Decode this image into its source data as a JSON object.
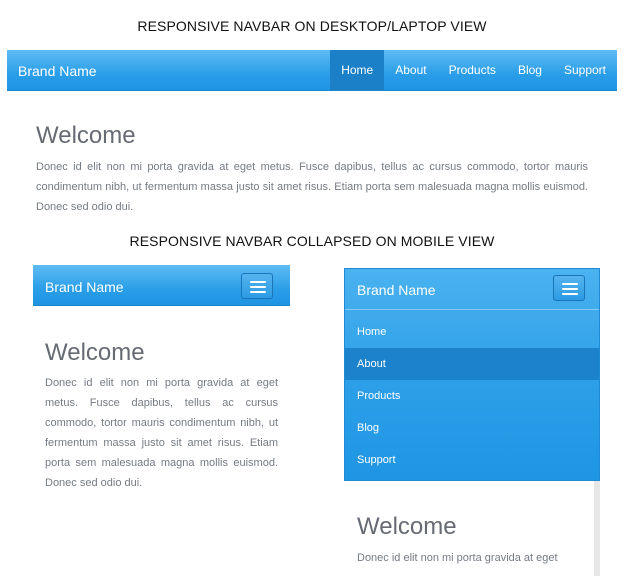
{
  "captions": {
    "desktop": "RESPONSIVE NAVBAR ON DESKTOP/LAPTOP VIEW",
    "mobile": "RESPONSIVE NAVBAR COLLAPSED ON MOBILE VIEW"
  },
  "navbar": {
    "brand": "Brand Name",
    "links": [
      "Home",
      "About",
      "Products",
      "Blog",
      "Support"
    ],
    "active": "Home"
  },
  "mobile_menu": {
    "items": [
      "Home",
      "About",
      "Products",
      "Blog",
      "Support"
    ],
    "active": "About"
  },
  "content": {
    "heading": "Welcome",
    "paragraph": "Donec id elit non mi porta gravida at eget metus. Fusce dapibus, tellus ac cursus commodo, tortor mauris condimentum nibh, ut fermentum massa justo sit amet risus. Etiam porta sem malesuada magna mollis euismod. Donec sed odio dui.",
    "paragraph_partial": "Donec id elit non mi porta gravida at eget"
  },
  "colors": {
    "navbar": "#2a9ee8",
    "active_item": "#1b80c8",
    "heading": "#666a73",
    "body_text": "#757b84"
  },
  "icons": {
    "menu_toggle": "hamburger-icon"
  }
}
